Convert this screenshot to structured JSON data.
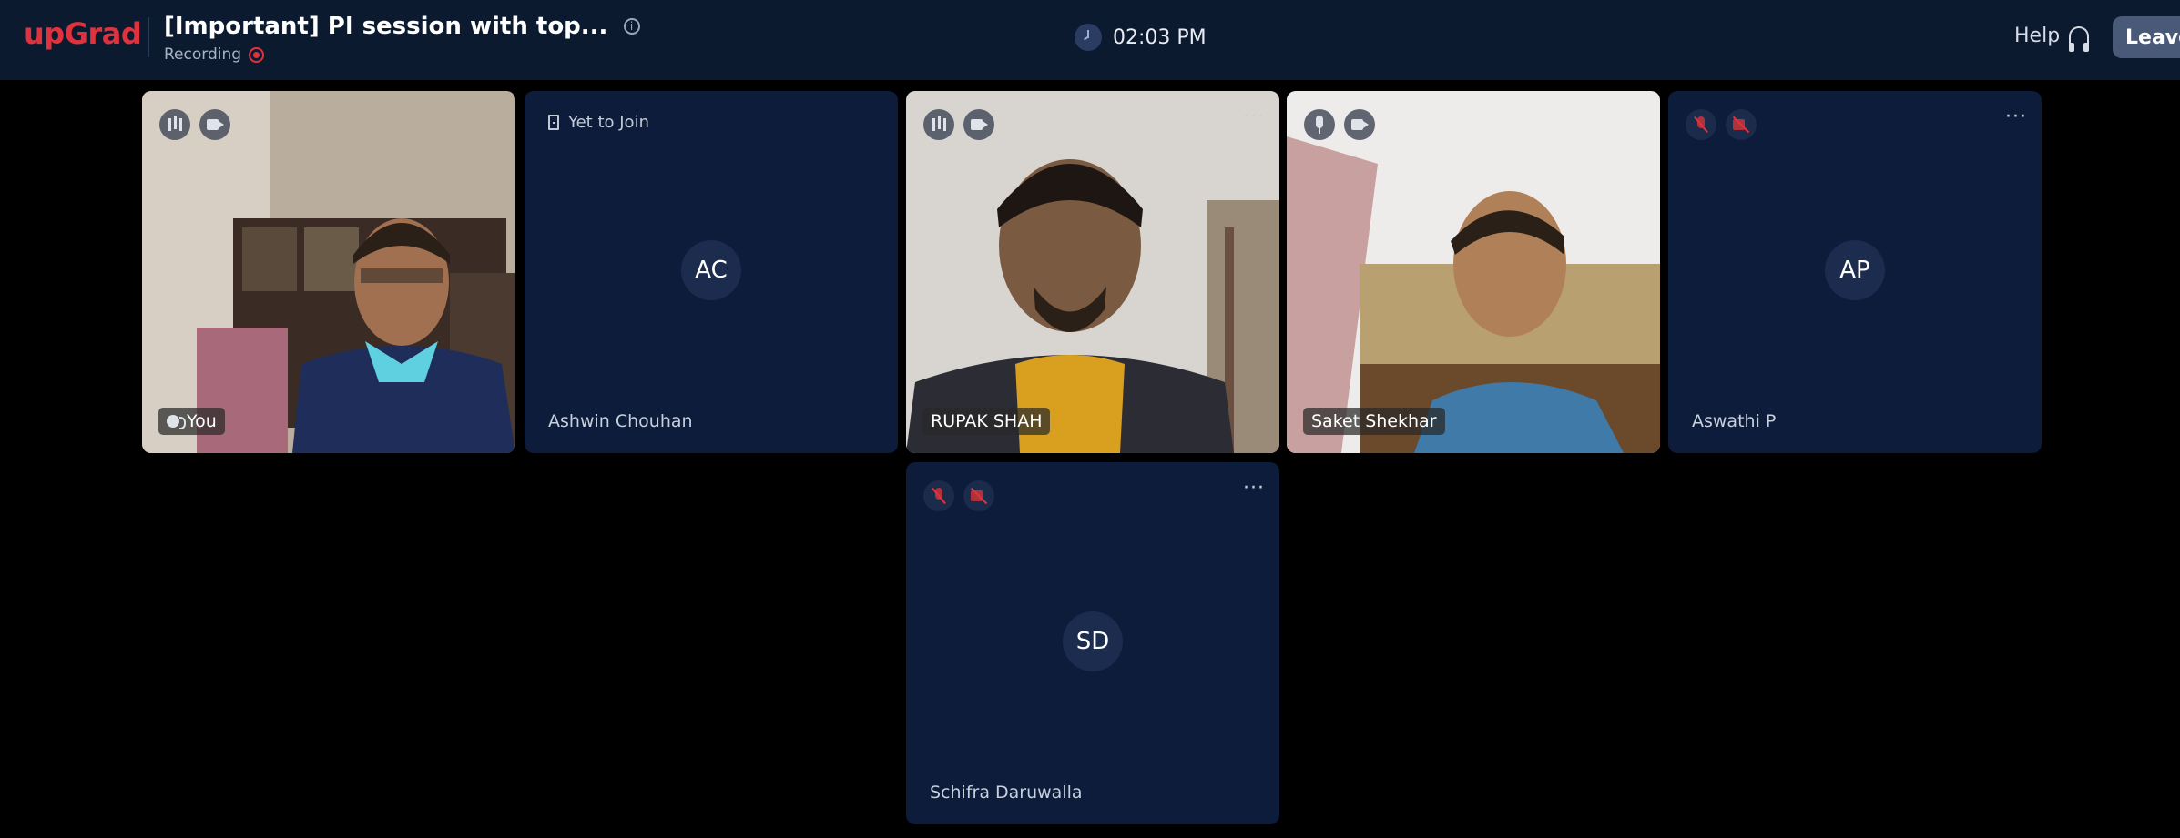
{
  "header": {
    "logo": "upGrad",
    "title": "[Important] PI session with top...",
    "info_icon": "i",
    "recording_label": "Recording",
    "time": "02:03 PM",
    "help_label": "Help",
    "leave_label": "Leave"
  },
  "tiles": [
    {
      "name": "You",
      "status": "video-on",
      "mic": "active",
      "camera": "on"
    },
    {
      "name": "Ashwin Chouhan",
      "initials": "AC",
      "status_label": "Yet to Join"
    },
    {
      "name": "RUPAK SHAH",
      "status": "video-on",
      "mic": "active",
      "camera": "on",
      "more": "···"
    },
    {
      "name": "Saket Shekhar",
      "status": "video-on",
      "mic": "on",
      "camera": "on"
    },
    {
      "name": "Aswathi P",
      "initials": "AP",
      "mic": "off",
      "camera": "off",
      "more": "···"
    },
    {
      "name": "Schifra Daruwalla",
      "initials": "SD",
      "mic": "off",
      "camera": "off",
      "more": "···"
    }
  ],
  "colors": {
    "brand": "#e0323d",
    "header_bg": "#0c1a30",
    "tile_bg": "#0c1c3a",
    "leave_bg": "#495978"
  }
}
